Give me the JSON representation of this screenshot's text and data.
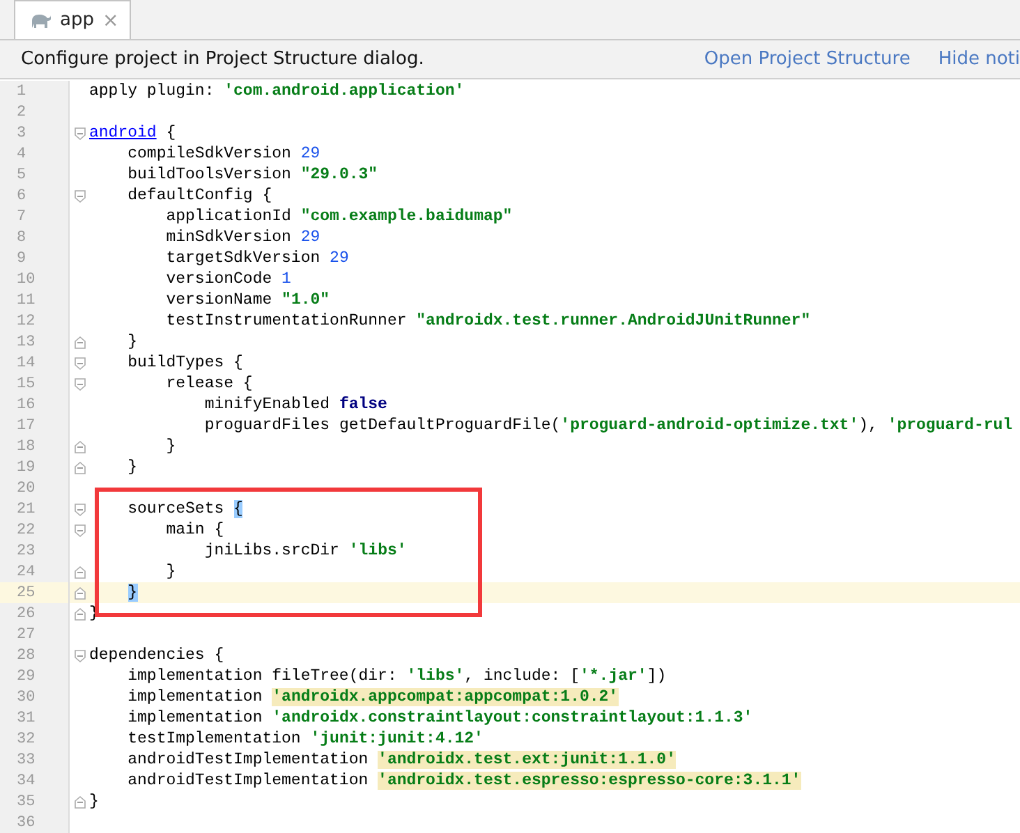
{
  "tab": {
    "label": "app",
    "close": "×",
    "selected": true
  },
  "notification": {
    "message": "Configure project in Project Structure dialog.",
    "actions": [
      "Open Project Structure",
      "Hide noti"
    ]
  },
  "editor": {
    "lines": [
      {
        "number": "1",
        "tokens": [
          {
            "text": "apply plugin: ",
            "kind": "plain"
          },
          {
            "text": "'com.android.application'",
            "kind": "string"
          }
        ]
      },
      {
        "number": "2"
      },
      {
        "number": "3",
        "fold_start": true,
        "tokens": [
          {
            "text": "android",
            "kind": "link"
          },
          {
            "text": " {",
            "kind": "plain"
          }
        ]
      },
      {
        "number": "4",
        "tokens": [
          {
            "text": "    compileSdkVersion ",
            "kind": "plain"
          },
          {
            "text": "29",
            "kind": "number"
          }
        ]
      },
      {
        "number": "5",
        "tokens": [
          {
            "text": "    buildToolsVersion ",
            "kind": "plain"
          },
          {
            "text": "\"29.0.3\"",
            "kind": "string"
          }
        ]
      },
      {
        "number": "6",
        "fold_start": true,
        "tokens": [
          {
            "text": "    defaultConfig {",
            "kind": "plain"
          }
        ]
      },
      {
        "number": "7",
        "tokens": [
          {
            "text": "        applicationId ",
            "kind": "plain"
          },
          {
            "text": "\"com.example.baidumap\"",
            "kind": "string"
          }
        ]
      },
      {
        "number": "8",
        "tokens": [
          {
            "text": "        minSdkVersion ",
            "kind": "plain"
          },
          {
            "text": "29",
            "kind": "number"
          }
        ]
      },
      {
        "number": "9",
        "tokens": [
          {
            "text": "        targetSdkVersion ",
            "kind": "plain"
          },
          {
            "text": "29",
            "kind": "number"
          }
        ]
      },
      {
        "number": "10",
        "tokens": [
          {
            "text": "        versionCode ",
            "kind": "plain"
          },
          {
            "text": "1",
            "kind": "number"
          }
        ]
      },
      {
        "number": "11",
        "tokens": [
          {
            "text": "        versionName ",
            "kind": "plain"
          },
          {
            "text": "\"1.0\"",
            "kind": "string"
          }
        ]
      },
      {
        "number": "12",
        "tokens": [
          {
            "text": "        testInstrumentationRunner ",
            "kind": "plain"
          },
          {
            "text": "\"androidx.test.runner.AndroidJUnitRunner\"",
            "kind": "string"
          }
        ]
      },
      {
        "number": "13",
        "fold_end": true,
        "tokens": [
          {
            "text": "    }",
            "kind": "plain"
          }
        ]
      },
      {
        "number": "14",
        "fold_start": true,
        "tokens": [
          {
            "text": "    buildTypes {",
            "kind": "plain"
          }
        ]
      },
      {
        "number": "15",
        "fold_start": true,
        "tokens": [
          {
            "text": "        release {",
            "kind": "plain"
          }
        ]
      },
      {
        "number": "16",
        "tokens": [
          {
            "text": "            minifyEnabled ",
            "kind": "plain"
          },
          {
            "text": "false",
            "kind": "keyword"
          }
        ]
      },
      {
        "number": "17",
        "tokens": [
          {
            "text": "            proguardFiles getDefaultProguardFile(",
            "kind": "plain"
          },
          {
            "text": "'proguard-android-optimize.txt'",
            "kind": "string"
          },
          {
            "text": "), ",
            "kind": "plain"
          },
          {
            "text": "'proguard-rul",
            "kind": "string"
          }
        ]
      },
      {
        "number": "18",
        "fold_end": true,
        "tokens": [
          {
            "text": "        }",
            "kind": "plain"
          }
        ]
      },
      {
        "number": "19",
        "fold_end": true,
        "tokens": [
          {
            "text": "    }",
            "kind": "plain"
          }
        ]
      },
      {
        "number": "20"
      },
      {
        "number": "21",
        "fold_start": true,
        "boxed": true,
        "tokens": [
          {
            "text": "    sourceSets ",
            "kind": "plain"
          },
          {
            "text": "{",
            "kind": "bracket"
          }
        ]
      },
      {
        "number": "22",
        "fold_start": true,
        "boxed": true,
        "tokens": [
          {
            "text": "        main {",
            "kind": "plain"
          }
        ]
      },
      {
        "number": "23",
        "boxed": true,
        "tokens": [
          {
            "text": "            jniLibs.srcDir ",
            "kind": "plain"
          },
          {
            "text": "'libs'",
            "kind": "string"
          }
        ]
      },
      {
        "number": "24",
        "fold_end": true,
        "boxed": true,
        "tokens": [
          {
            "text": "        }",
            "kind": "plain"
          }
        ]
      },
      {
        "number": "25",
        "fold_end": true,
        "boxed": true,
        "current": true,
        "tokens": [
          {
            "text": "    }",
            "kind": "bracket"
          }
        ]
      },
      {
        "number": "26",
        "fold_end": true,
        "tokens": [
          {
            "text": "}",
            "kind": "plain"
          }
        ]
      },
      {
        "number": "27"
      },
      {
        "number": "28",
        "fold_start": true,
        "tokens": [
          {
            "text": "dependencies {",
            "kind": "plain"
          }
        ]
      },
      {
        "number": "29",
        "tokens": [
          {
            "text": "    implementation fileTree(dir: ",
            "kind": "plain"
          },
          {
            "text": "'libs'",
            "kind": "string"
          },
          {
            "text": ", include: [",
            "kind": "plain"
          },
          {
            "text": "'*.jar'",
            "kind": "string"
          },
          {
            "text": "])",
            "kind": "plain"
          }
        ]
      },
      {
        "number": "30",
        "tokens": [
          {
            "text": "    implementation ",
            "kind": "plain"
          },
          {
            "text": "'androidx.appcompat:appcompat:1.0.2'",
            "kind": "marked"
          }
        ]
      },
      {
        "number": "31",
        "tokens": [
          {
            "text": "    implementation ",
            "kind": "plain"
          },
          {
            "text": "'androidx.constraintlayout:constraintlayout:1.1.3'",
            "kind": "string"
          }
        ]
      },
      {
        "number": "32",
        "tokens": [
          {
            "text": "    testImplementation ",
            "kind": "plain"
          },
          {
            "text": "'junit:junit:4.12'",
            "kind": "string"
          }
        ]
      },
      {
        "number": "33",
        "tokens": [
          {
            "text": "    androidTestImplementation ",
            "kind": "plain"
          },
          {
            "text": "'androidx.test.ext:junit:1.1.0'",
            "kind": "marked"
          }
        ]
      },
      {
        "number": "34",
        "tokens": [
          {
            "text": "    androidTestImplementation ",
            "kind": "plain"
          },
          {
            "text": "'androidx.test.espresso:espresso-core:3.1.1'",
            "kind": "marked"
          }
        ]
      },
      {
        "number": "35",
        "fold_end": true,
        "tokens": [
          {
            "text": "}",
            "kind": "plain"
          }
        ]
      },
      {
        "number": "36"
      }
    ]
  }
}
